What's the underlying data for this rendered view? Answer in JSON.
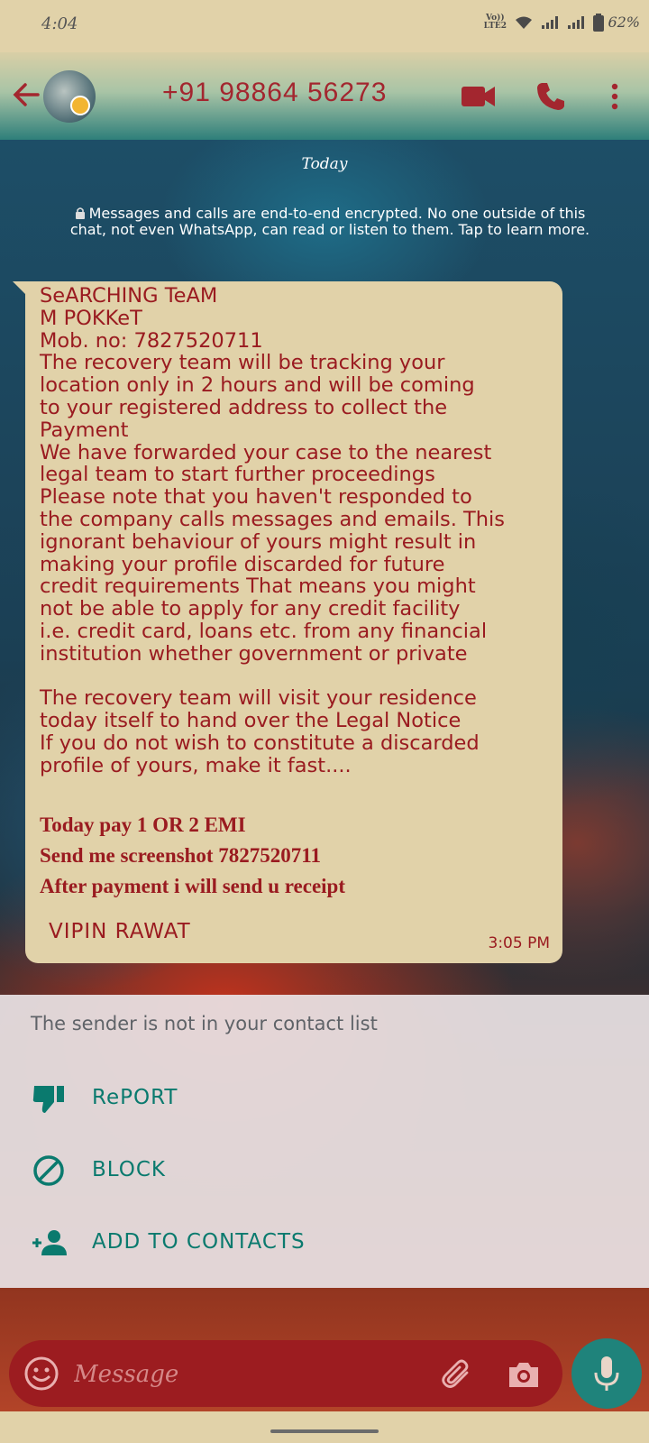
{
  "status_bar": {
    "time": "4:04",
    "network": "Vo))\nLTE2",
    "battery": "62%"
  },
  "header": {
    "contact": "+91 98864 56273"
  },
  "chat": {
    "date_label": "Today",
    "encryption_notice": "Messages and calls are end-to-end encrypted. No one outside of this chat, not even WhatsApp, can read or listen to them. Tap to learn more.",
    "message": {
      "body": "SeARCHING TeAM\nM POKKeT\nMob. no: 7827520711\nThe recovery team will be tracking your\nlocation only in 2 hours and will be coming\nto your registered address to collect the\nPayment\nWe have forwarded your case to the nearest\nlegal team to start further proceedings\nPlease note that you haven't responded to\nthe company calls messages and emails. This\nignorant behaviour of yours might result in\nmaking your profile discarded for future\ncredit requirements That means you might\nnot be able to apply for any credit facility\ni.e. credit card, loans etc. from any financial\ninstitution whether government or private\n\nThe recovery team will visit your residence\ntoday itself to hand over the Legal Notice\nIf you do not wish to constitute a discarded\nprofile of yours, make it fast....",
      "line1": "Today pay 1 OR 2 EMI",
      "line2": "Send me screenshot 7827520711",
      "line3": "After payment i will send u receipt",
      "signature": "VIPIN RAWAT",
      "time": "3:05 PM"
    }
  },
  "unknown_sender_panel": {
    "notice": "The sender is not in your contact list",
    "report_label": "RePORT",
    "block_label": "BLOCK",
    "add_label": "ADD TO CONTACTS"
  },
  "composer": {
    "placeholder": "Message"
  },
  "colors": {
    "accent": "#9c1c20",
    "teal": "#1f837b",
    "bubble": "#e1d2a9",
    "action_text": "#0a7a6e"
  },
  "icons": [
    "back-arrow-icon",
    "video-call-icon",
    "phone-icon",
    "more-icon",
    "lock-icon",
    "thumbs-down-icon",
    "block-icon",
    "add-contact-icon",
    "emoji-icon",
    "attach-icon",
    "camera-icon",
    "mic-icon"
  ]
}
